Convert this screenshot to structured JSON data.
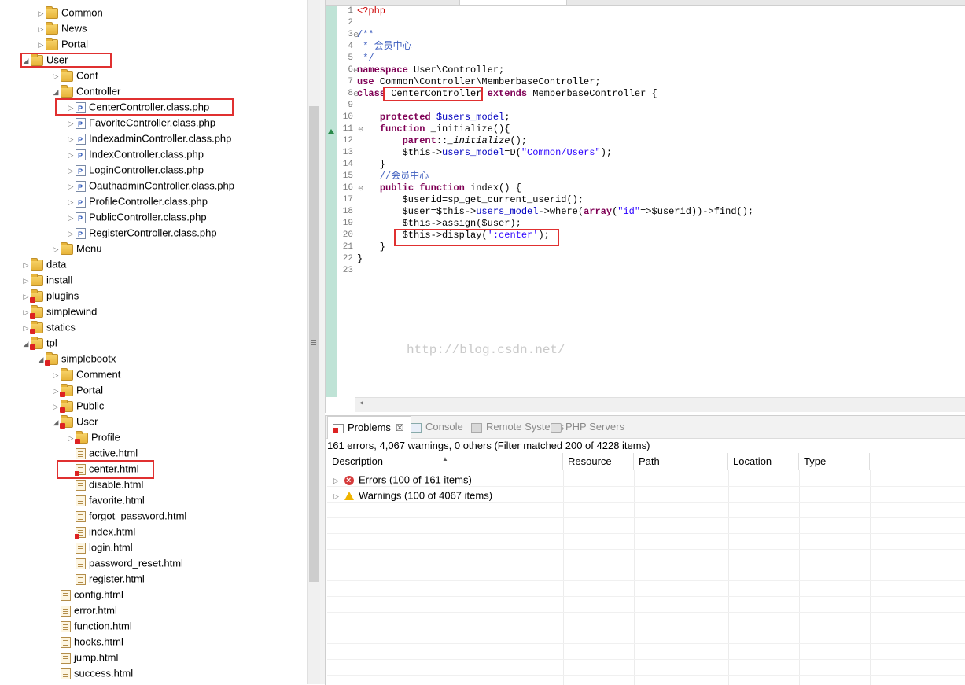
{
  "tree": {
    "items": [
      {
        "label": "Common",
        "icon": "package-folder-icon",
        "arrow": "collapsed"
      },
      {
        "label": "News",
        "icon": "package-folder-icon",
        "arrow": "collapsed"
      },
      {
        "label": "Portal",
        "icon": "package-folder-icon",
        "arrow": "collapsed"
      },
      {
        "label": "User",
        "icon": "package-folder-icon",
        "arrow": "expanded"
      },
      {
        "label": "Conf",
        "icon": "package-folder-icon",
        "arrow": "collapsed"
      },
      {
        "label": "Controller",
        "icon": "package-folder-icon",
        "arrow": "expanded"
      },
      {
        "label": "CenterController.class.php",
        "icon": "php-file-icon",
        "arrow": "collapsed"
      },
      {
        "label": "FavoriteController.class.php",
        "icon": "php-file-icon",
        "arrow": "collapsed"
      },
      {
        "label": "IndexadminController.class.php",
        "icon": "php-file-icon",
        "arrow": "collapsed"
      },
      {
        "label": "IndexController.class.php",
        "icon": "php-file-icon",
        "arrow": "collapsed"
      },
      {
        "label": "LoginController.class.php",
        "icon": "php-file-icon",
        "arrow": "collapsed"
      },
      {
        "label": "OauthadminController.class.php",
        "icon": "php-file-icon",
        "arrow": "collapsed"
      },
      {
        "label": "ProfileController.class.php",
        "icon": "php-file-icon",
        "arrow": "collapsed"
      },
      {
        "label": "PublicController.class.php",
        "icon": "php-file-icon",
        "arrow": "collapsed"
      },
      {
        "label": "RegisterController.class.php",
        "icon": "php-file-icon",
        "arrow": "collapsed"
      },
      {
        "label": "Menu",
        "icon": "package-folder-icon",
        "arrow": "collapsed"
      },
      {
        "label": "data",
        "icon": "package-folder-icon",
        "arrow": "collapsed"
      },
      {
        "label": "install",
        "icon": "package-folder-icon",
        "arrow": "collapsed"
      },
      {
        "label": "plugins",
        "icon": "package-folder-error-icon",
        "arrow": "collapsed"
      },
      {
        "label": "simplewind",
        "icon": "package-folder-error-icon",
        "arrow": "collapsed"
      },
      {
        "label": "statics",
        "icon": "package-folder-error-icon",
        "arrow": "collapsed"
      },
      {
        "label": "tpl",
        "icon": "package-folder-error-icon",
        "arrow": "expanded"
      },
      {
        "label": "simplebootx",
        "icon": "package-folder-error-icon",
        "arrow": "expanded"
      },
      {
        "label": "Comment",
        "icon": "package-folder-icon",
        "arrow": "collapsed"
      },
      {
        "label": "Portal",
        "icon": "package-folder-error-icon",
        "arrow": "collapsed"
      },
      {
        "label": "Public",
        "icon": "package-folder-error-icon",
        "arrow": "collapsed"
      },
      {
        "label": "User",
        "icon": "package-folder-error-icon",
        "arrow": "expanded"
      },
      {
        "label": "Profile",
        "icon": "package-folder-error-icon",
        "arrow": "collapsed"
      },
      {
        "label": "active.html",
        "icon": "html-file-icon",
        "arrow": "none"
      },
      {
        "label": "center.html",
        "icon": "html-file-error-icon",
        "arrow": "none"
      },
      {
        "label": "disable.html",
        "icon": "html-file-icon",
        "arrow": "none"
      },
      {
        "label": "favorite.html",
        "icon": "html-file-icon",
        "arrow": "none"
      },
      {
        "label": "forgot_password.html",
        "icon": "html-file-icon",
        "arrow": "none"
      },
      {
        "label": "index.html",
        "icon": "html-file-error-icon",
        "arrow": "none"
      },
      {
        "label": "login.html",
        "icon": "html-file-icon",
        "arrow": "none"
      },
      {
        "label": "password_reset.html",
        "icon": "html-file-icon",
        "arrow": "none"
      },
      {
        "label": "register.html",
        "icon": "html-file-icon",
        "arrow": "none"
      },
      {
        "label": "config.html",
        "icon": "html-file-icon",
        "arrow": "none"
      },
      {
        "label": "error.html",
        "icon": "html-file-icon",
        "arrow": "none"
      },
      {
        "label": "function.html",
        "icon": "html-file-icon",
        "arrow": "none"
      },
      {
        "label": "hooks.html",
        "icon": "html-file-icon",
        "arrow": "none"
      },
      {
        "label": "jump.html",
        "icon": "html-file-icon",
        "arrow": "none"
      },
      {
        "label": "success.html",
        "icon": "html-file-icon",
        "arrow": "none"
      }
    ]
  },
  "editor": {
    "line_numbers": [
      "1",
      "2",
      "3",
      "4",
      "5",
      "6",
      "7",
      "8",
      "9",
      "10",
      "11",
      "12",
      "13",
      "14",
      "15",
      "16",
      "17",
      "18",
      "19",
      "20",
      "21",
      "22",
      "23"
    ],
    "lines": [
      [
        {
          "t": "<?php",
          "c": "phpt"
        }
      ],
      [],
      [
        {
          "t": "/**",
          "c": "cm"
        }
      ],
      [
        {
          "t": " * 会员中心",
          "c": "cm"
        }
      ],
      [
        {
          "t": " */",
          "c": "cm"
        }
      ],
      [
        {
          "t": "namespace",
          "c": "kw"
        },
        {
          "t": " User\\Controller;",
          "c": ""
        }
      ],
      [
        {
          "t": "use",
          "c": "kw"
        },
        {
          "t": " Common\\Controller\\MemberbaseController;",
          "c": ""
        }
      ],
      [
        {
          "t": "class",
          "c": "kw"
        },
        {
          "t": " CenterController ",
          "c": ""
        },
        {
          "t": "extends",
          "c": "kw"
        },
        {
          "t": " MemberbaseController {",
          "c": ""
        }
      ],
      [],
      [
        {
          "t": "    ",
          "c": ""
        },
        {
          "t": "protected",
          "c": "kw"
        },
        {
          "t": " ",
          "c": ""
        },
        {
          "t": "$users_model",
          "c": "var"
        },
        {
          "t": ";",
          "c": ""
        }
      ],
      [
        {
          "t": "    ",
          "c": ""
        },
        {
          "t": "function",
          "c": "kw"
        },
        {
          "t": " _initialize(){",
          "c": ""
        }
      ],
      [
        {
          "t": "        ",
          "c": ""
        },
        {
          "t": "parent",
          "c": "kw"
        },
        {
          "t": "::",
          "c": ""
        },
        {
          "t": "_initialize",
          "c": "ital"
        },
        {
          "t": "();",
          "c": ""
        }
      ],
      [
        {
          "t": "        $this->",
          "c": ""
        },
        {
          "t": "users_model",
          "c": "field"
        },
        {
          "t": "=D(",
          "c": ""
        },
        {
          "t": "\"Common/Users\"",
          "c": "str"
        },
        {
          "t": ");",
          "c": ""
        }
      ],
      [
        {
          "t": "    }",
          "c": ""
        }
      ],
      [
        {
          "t": "    //会员中心",
          "c": "cm"
        }
      ],
      [
        {
          "t": "    ",
          "c": ""
        },
        {
          "t": "public",
          "c": "kw"
        },
        {
          "t": " ",
          "c": ""
        },
        {
          "t": "function",
          "c": "kw"
        },
        {
          "t": " index() {",
          "c": ""
        }
      ],
      [
        {
          "t": "        $userid=sp_get_current_userid();",
          "c": ""
        }
      ],
      [
        {
          "t": "        $user=$this->",
          "c": ""
        },
        {
          "t": "users_model",
          "c": "field"
        },
        {
          "t": "->where(",
          "c": ""
        },
        {
          "t": "array",
          "c": "kw"
        },
        {
          "t": "(",
          "c": ""
        },
        {
          "t": "\"id\"",
          "c": "str"
        },
        {
          "t": "=>$userid))->find();",
          "c": ""
        }
      ],
      [
        {
          "t": "        $this->assign($user);",
          "c": ""
        }
      ],
      [
        {
          "t": "        $this->display(",
          "c": ""
        },
        {
          "t": "':center'",
          "c": "str"
        },
        {
          "t": ");",
          "c": ""
        }
      ],
      [
        {
          "t": "    }",
          "c": ""
        }
      ],
      [
        {
          "t": "}",
          "c": ""
        }
      ],
      []
    ],
    "watermark": "http://blog.csdn.net/"
  },
  "problems": {
    "tabs": [
      {
        "label": "Problems",
        "icon": "problems-icon",
        "active": true
      },
      {
        "label": "Console",
        "icon": "console-icon",
        "active": false
      },
      {
        "label": "Remote Systems",
        "icon": "remote-systems-icon",
        "active": false
      },
      {
        "label": "PHP Servers",
        "icon": "php-servers-icon",
        "active": false
      }
    ],
    "close_glyph": "☒",
    "summary": "161 errors, 4,067 warnings, 0 others (Filter matched 200 of 4228 items)",
    "columns": [
      "Description",
      "Resource",
      "Path",
      "Location",
      "Type"
    ],
    "rows": [
      {
        "label": "Errors (100 of 161 items)",
        "icon": "error-icon"
      },
      {
        "label": "Warnings (100 of 4067 items)",
        "icon": "warning-icon"
      }
    ]
  }
}
